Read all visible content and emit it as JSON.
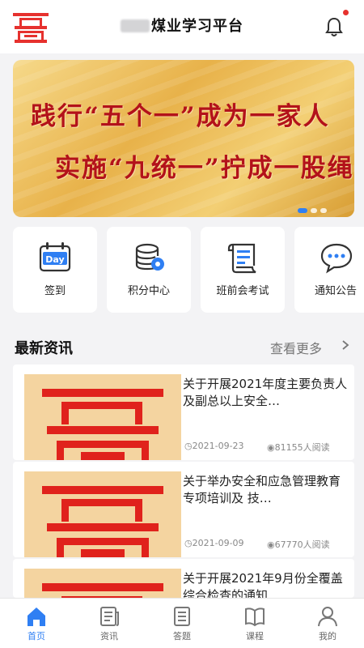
{
  "header": {
    "title": "煤业学习平台"
  },
  "banner": {
    "line1": "践行“五个一”成为一家人",
    "line2": "实施“九统一”拧成一股绳"
  },
  "quick": [
    {
      "label": "签到",
      "icon": "calendar-day-icon",
      "day_text": "Day"
    },
    {
      "label": "积分中心",
      "icon": "coins-icon"
    },
    {
      "label": "班前会考试",
      "icon": "exam-scroll-icon"
    },
    {
      "label": "通知公告",
      "icon": "chat-bubble-icon"
    }
  ],
  "news_section": {
    "title": "最新资讯",
    "more": "查看更多"
  },
  "news": [
    {
      "title": "关于开展2021年度主要负责人及副总以上安全…",
      "date": "2021-09-23",
      "reads": "81155人阅读"
    },
    {
      "title": "关于举办安全和应急管理教育专项培训及 技…",
      "date": "2021-09-09",
      "reads": "67770人阅读"
    },
    {
      "title": "关于开展2021年9月份全覆盖综合检查的通知…",
      "date": "",
      "reads": ""
    }
  ],
  "tabs": [
    {
      "label": "首页",
      "icon": "home-icon",
      "active": true
    },
    {
      "label": "资讯",
      "icon": "news-icon",
      "active": false
    },
    {
      "label": "答题",
      "icon": "quiz-icon",
      "active": false
    },
    {
      "label": "课程",
      "icon": "book-icon",
      "active": false
    },
    {
      "label": "我的",
      "icon": "user-icon",
      "active": false
    }
  ],
  "colors": {
    "brand_red": "#e6312e",
    "accent_blue": "#2f7ff3",
    "banner_text": "#b3121a"
  }
}
